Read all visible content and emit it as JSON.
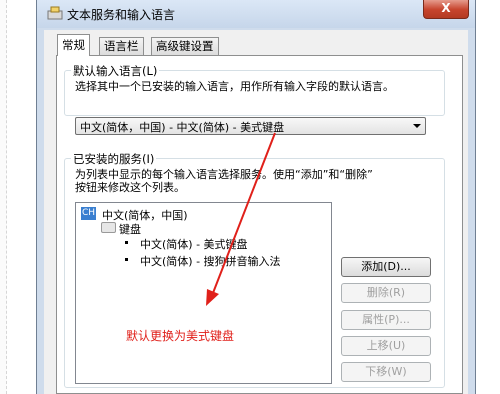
{
  "window": {
    "title": "文本服务和输入语言",
    "close_label": "X"
  },
  "tabs": [
    {
      "label": "常规",
      "active": true
    },
    {
      "label": "语言栏",
      "active": false
    },
    {
      "label": "高级键设置",
      "active": false
    }
  ],
  "default_language": {
    "group_title": "默认输入语言(L)",
    "description": "选择其中一个已安装的输入语言，用作所有输入字段的默认语言。",
    "selected_value": "中文(简体，中国) - 中文(简体) - 美式键盘"
  },
  "installed_services": {
    "group_title": "已安装的服务(I)",
    "description_line1": "为列表中显示的每个输入语言选择服务。使用“添加”和“删除”",
    "description_line2": "按钮来修改这个列表。",
    "tree": {
      "language_icon": "CH",
      "language": "中文(简体，中国)",
      "category": "键盘",
      "items": [
        "中文(简体) - 美式键盘",
        "中文(简体) - 搜狗拼音输入法"
      ]
    }
  },
  "buttons": {
    "add": "添加(D)...",
    "remove": "删除(R)",
    "properties": "属性(P)...",
    "move_up": "上移(U)",
    "move_down": "下移(W)"
  },
  "annotation": {
    "text": "默认更换为美式键盘",
    "color": "#e0201a"
  }
}
